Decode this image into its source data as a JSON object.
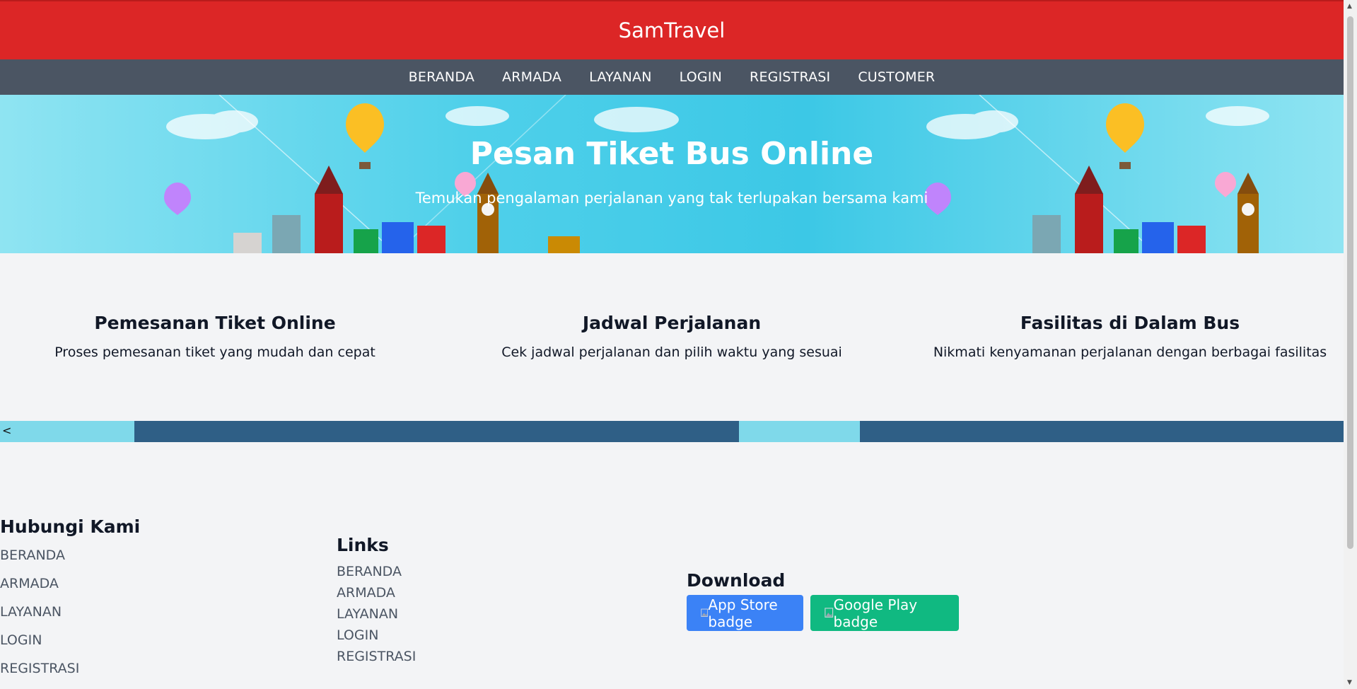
{
  "header": {
    "brand": "SamTravel"
  },
  "nav": {
    "items": [
      "BERANDA",
      "ARMADA",
      "LAYANAN",
      "LOGIN",
      "REGISTRASI",
      "CUSTOMER"
    ]
  },
  "hero": {
    "title": "Pesan Tiket Bus Online",
    "subtitle": "Temukan pengalaman perjalanan yang tak terlupakan bersama kami"
  },
  "features": [
    {
      "title": "Pemesanan Tiket Online",
      "desc": "Proses pemesanan tiket yang mudah dan cepat"
    },
    {
      "title": "Jadwal Perjalanan",
      "desc": "Cek jadwal perjalanan dan pilih waktu yang sesuai"
    },
    {
      "title": "Fasilitas di Dalam Bus",
      "desc": "Nikmati kenyamanan perjalanan dengan berbagai fasilitas"
    }
  ],
  "strip": {
    "arrow": "<"
  },
  "footer": {
    "contact": {
      "title": "Hubungi Kami",
      "links": [
        "BERANDA",
        "ARMADA",
        "LAYANAN",
        "LOGIN",
        "REGISTRASI"
      ]
    },
    "links": {
      "title": "Links",
      "links": [
        "BERANDA",
        "ARMADA",
        "LAYANAN",
        "LOGIN",
        "REGISTRASI"
      ]
    },
    "download": {
      "title": "Download",
      "app_store_alt": "App Store badge",
      "google_play_alt": "Google Play badge"
    }
  },
  "colors": {
    "brand_red": "#dc2626",
    "nav_gray": "#4b5563",
    "app_store_blue": "#3b82f6",
    "google_play_green": "#10b981",
    "page_bg": "#f3f4f6"
  },
  "icons": [
    "broken-image-icon",
    "hot-air-balloon-icon",
    "landmark-illustration"
  ]
}
